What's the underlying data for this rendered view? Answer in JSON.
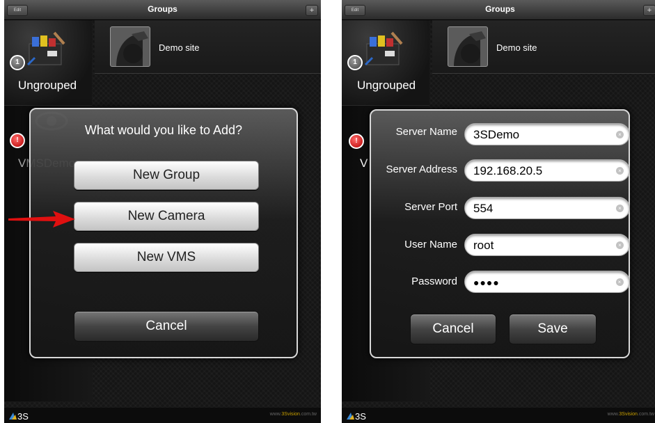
{
  "left_screen": {
    "navbar": {
      "title": "Groups",
      "edit_label": "Edit",
      "add_label": "+"
    },
    "sidebar": {
      "ungrouped": {
        "badge": "1",
        "label": "Ungrouped"
      },
      "vms": {
        "badge": "!",
        "label": "VMSDemo"
      }
    },
    "site": {
      "name": "Demo site"
    },
    "dialog": {
      "title": "What would you like to Add?",
      "new_group": "New Group",
      "new_camera": "New Camera",
      "new_vms": "New VMS",
      "cancel": "Cancel"
    },
    "footer": {
      "url_prefix": "www.",
      "url_brand": "3Svision",
      "url_suffix": ".com.tw"
    }
  },
  "right_screen": {
    "navbar": {
      "title": "Groups",
      "edit_label": "Edit",
      "add_label": "+"
    },
    "sidebar": {
      "ungrouped": {
        "badge": "1",
        "label": "Ungrouped"
      },
      "vms": {
        "badge": "!",
        "label": "V"
      }
    },
    "site": {
      "name": "Demo site"
    },
    "form": {
      "server_name_label": "Server Name",
      "server_name_value": "3SDemo",
      "server_address_label": "Server Address",
      "server_address_value": "192.168.20.5",
      "server_port_label": "Server Port",
      "server_port_value": "554",
      "user_name_label": "User Name",
      "user_name_value": "root",
      "password_label": "Password",
      "password_value": "●●●●",
      "cancel": "Cancel",
      "save": "Save"
    },
    "footer": {
      "url_prefix": "www.",
      "url_brand": "3Svision",
      "url_suffix": ".com.tw"
    }
  },
  "colors": {
    "accent_arrow": "#e01010",
    "badge_red": "#c00000",
    "brand_gold": "#c8a000"
  }
}
